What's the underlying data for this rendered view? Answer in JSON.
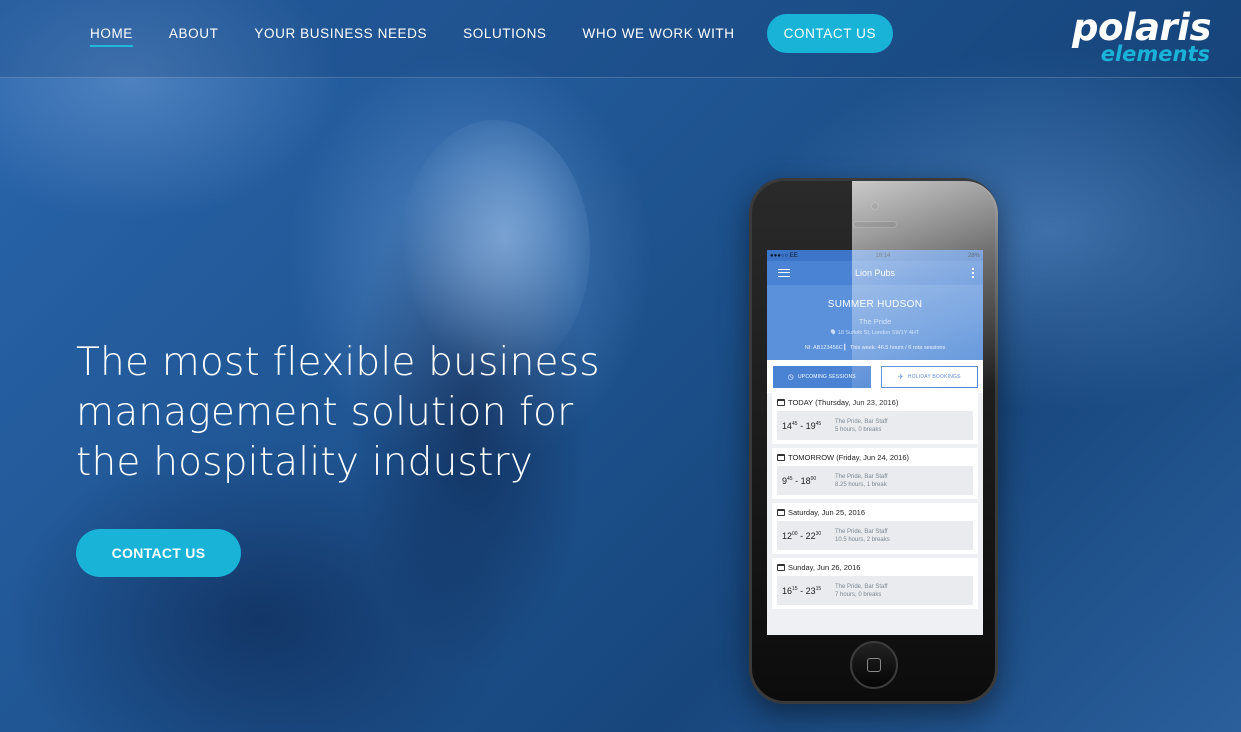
{
  "nav": {
    "items": [
      "HOME",
      "ABOUT",
      "YOUR BUSINESS NEEDS",
      "SOLUTIONS",
      "WHO WE WORK WITH"
    ],
    "active": "HOME",
    "cta": "CONTACT US"
  },
  "logo": {
    "top": "polaris",
    "bottom": "elements"
  },
  "hero": {
    "headline": "The most flexible business management solution for the hospitality industry",
    "cta": "CONTACT US"
  },
  "colors": {
    "accent": "#1ab3d8",
    "app_bar": "#4a83d4",
    "hero_tint": "#1e538f"
  },
  "phone_app": {
    "status_left": "●●●○○ EE",
    "status_time": "18:14",
    "status_battery": "28%",
    "title": "Lion Pubs",
    "employee": "SUMMER HUDSON",
    "venue": "The Pride",
    "address": "18 Suffolk St, London SW1Y 4HT",
    "ni_line": "NI: AB123456C  ▎ This week: 46.5 hours / 6 rota sessions",
    "tabs": [
      "UPCOMING SESSIONS",
      "HOLIDAY BOOKINGS"
    ],
    "days": [
      {
        "title": "TODAY (Thursday, Jun 23, 2016)",
        "start_h": "14",
        "start_m": "45",
        "end_h": "19",
        "end_m": "45",
        "role": "The Pride, Bar Staff",
        "detail": "5 hours, 0 breaks"
      },
      {
        "title": "TOMORROW (Friday, Jun 24, 2016)",
        "start_h": "9",
        "start_m": "45",
        "end_h": "18",
        "end_m": "00",
        "role": "The Pride, Bar Staff",
        "detail": "8.25 hours, 1 break"
      },
      {
        "title": "Saturday, Jun 25, 2016",
        "start_h": "12",
        "start_m": "00",
        "end_h": "22",
        "end_m": "30",
        "role": "The Pride, Bar Staff",
        "detail": "10.5 hours, 2 breaks"
      },
      {
        "title": "Sunday, Jun 26, 2016",
        "start_h": "16",
        "start_m": "15",
        "end_h": "23",
        "end_m": "15",
        "role": "The Pride, Bar Staff",
        "detail": "7 hours, 0 breaks"
      }
    ]
  }
}
